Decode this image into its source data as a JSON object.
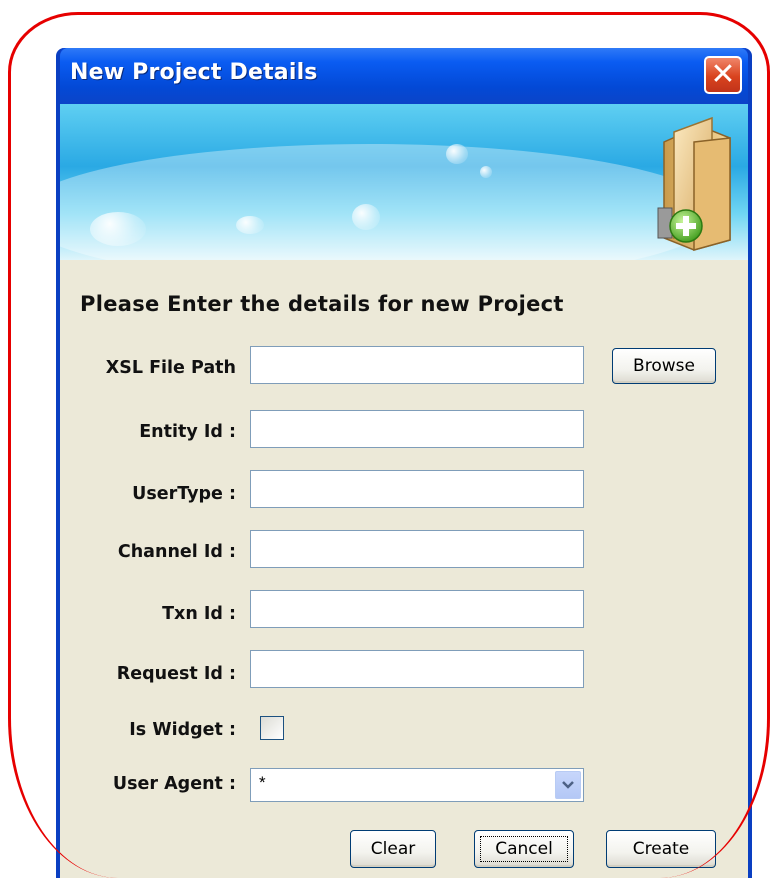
{
  "window": {
    "title": "New Project Details",
    "close_glyph": "✕"
  },
  "form": {
    "heading": "Please Enter the details for new Project",
    "fields": [
      {
        "label": "XSL File Path",
        "value": ""
      },
      {
        "label": "Entity Id :",
        "value": ""
      },
      {
        "label": "UserType :",
        "value": ""
      },
      {
        "label": "Channel Id :",
        "value": ""
      },
      {
        "label": "Txn Id :",
        "value": ""
      },
      {
        "label": "Request Id :",
        "value": ""
      }
    ],
    "is_widget_label": "Is Widget :",
    "is_widget_checked": false,
    "user_agent_label": "User Agent :",
    "user_agent_value": "*"
  },
  "buttons": {
    "browse": "Browse",
    "clear": "Clear",
    "cancel": "Cancel",
    "create": "Create"
  },
  "colors": {
    "highlight_outline": "#e60000",
    "titlebar": "#0a5cf2",
    "dialog_background": "#ece9d8",
    "close_button": "#d9431e"
  },
  "icons": {
    "banner": "folder-add-icon",
    "close": "close-icon",
    "dropdown": "chevron-down-icon"
  }
}
